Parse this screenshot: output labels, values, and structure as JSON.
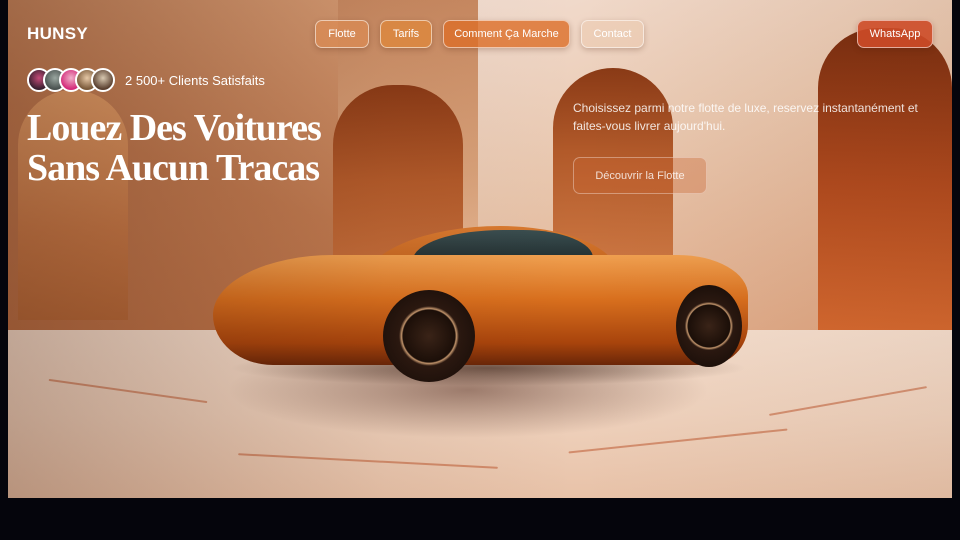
{
  "brand": {
    "name": "HUNSY"
  },
  "nav": {
    "items": [
      {
        "label": "Flotte"
      },
      {
        "label": "Tarifs"
      },
      {
        "label": "Comment Ça Marche"
      },
      {
        "label": "Contact"
      }
    ],
    "whatsapp_label": "WhatsApp"
  },
  "hero": {
    "clients_label": "2 500+ Clients Satisfaits",
    "headline_line1": "Louez Des Voitures",
    "headline_line2": "Sans Aucun Tracas",
    "tagline": "Choisissez parmi notre flotte de luxe, reservez instantanément et faites-vous livrer aujourd'hui.",
    "cta_label": "Découvrir la Flotte"
  },
  "icons": {
    "avatars": [
      "avatar",
      "avatar",
      "avatar",
      "avatar",
      "avatar"
    ]
  },
  "colors": {
    "accent": "#cd4b28",
    "text": "#ffffff"
  }
}
